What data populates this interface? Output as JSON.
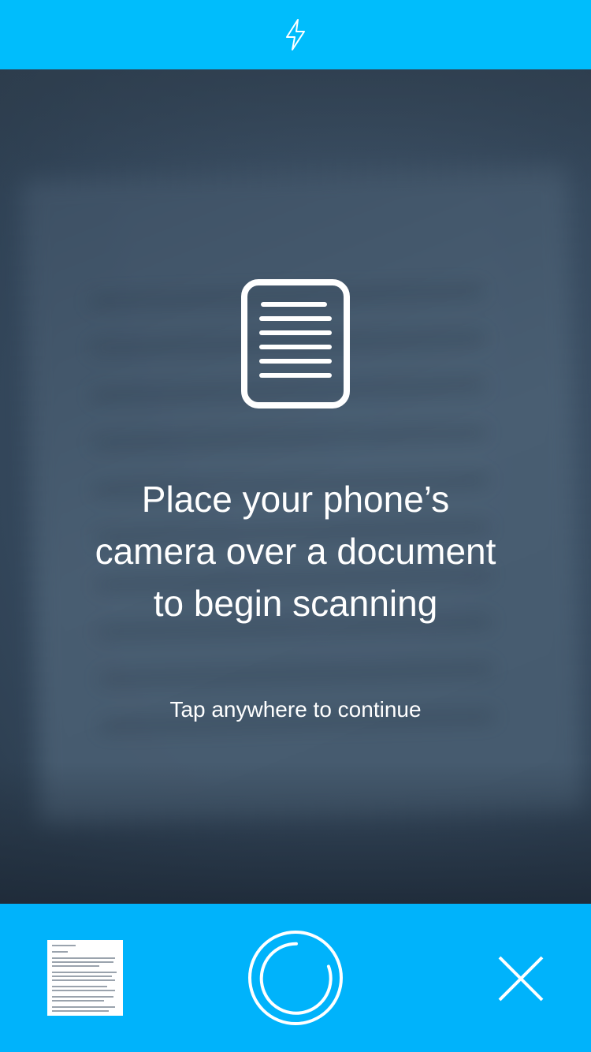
{
  "top_bar": {
    "flash_icon": "lightning-bolt-icon",
    "color": "#00bdfc"
  },
  "onboarding": {
    "document_icon": "document-icon",
    "headline": "Place your phone’s\ncamera over a document\nto begin scanning",
    "hint": "Tap anywhere to continue"
  },
  "bottom_bar": {
    "color": "#00b3fb",
    "thumbnail": "last-scan-thumbnail",
    "shutter_icon": "shutter-icon",
    "close_icon": "close-icon"
  }
}
